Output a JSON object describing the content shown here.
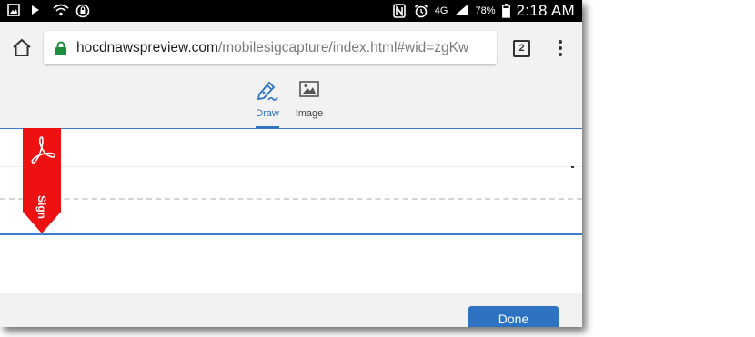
{
  "status_bar": {
    "battery_percent": "78%",
    "network": "4G",
    "time": "2:18 AM",
    "left_icons": [
      "gallery-icon",
      "play-icon",
      "wifi-icon",
      "vpn-icon"
    ],
    "right_icons": [
      "nfc-icon",
      "alarm-icon",
      "signal-icon",
      "battery-icon"
    ]
  },
  "browser": {
    "url_domain": "hocdnawspreview.com",
    "url_path": "/mobilesigcapture/index.html#wid=zgKw",
    "tab_count": "2"
  },
  "mode_tabs": [
    {
      "label": "Draw",
      "icon": "pen-icon",
      "selected": true
    },
    {
      "label": "Image",
      "icon": "image-icon",
      "selected": false
    }
  ],
  "signature": {
    "flag_label": "Sign",
    "flag_icon": "acrobat-icon"
  },
  "footer": {
    "done_label": "Done"
  },
  "colors": {
    "accent": "#2d73c2",
    "flag": "#ee1111",
    "secure": "#1e8e3e"
  }
}
